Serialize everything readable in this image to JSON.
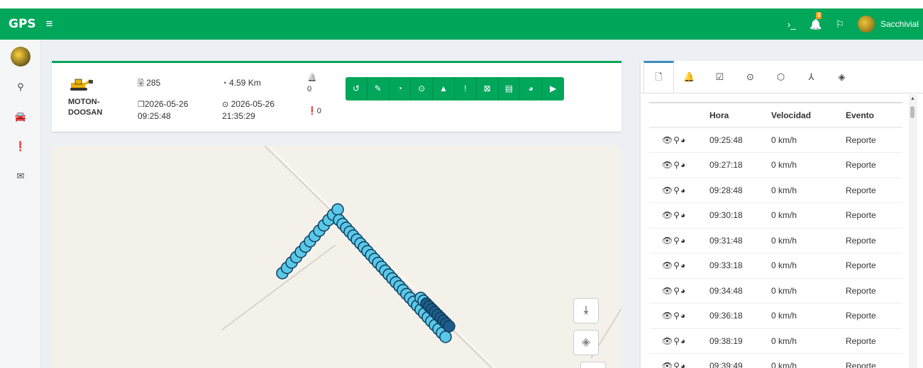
{
  "navbar": {
    "brand": "GPS",
    "menu_icon": "≡",
    "terminal_icon": "›_",
    "bell_icon": "🔔",
    "bell_badge": "0",
    "flag_icon": "⚐",
    "username": "Sacchivial",
    "color": "#00a65a"
  },
  "sidebar": {
    "items": [
      {
        "name": "location-icon",
        "glyph": "⚲"
      },
      {
        "name": "car-icon",
        "glyph": "🚘"
      },
      {
        "name": "alert-icon",
        "glyph": "❗"
      },
      {
        "name": "mail-icon",
        "glyph": "✉"
      }
    ]
  },
  "vehicle": {
    "name_line1": "MOTON-",
    "name_line2": "DOOSAN",
    "count": "285",
    "distance": "4.59 Km",
    "start_date": "2026-05-26",
    "start_time": "09:25:48",
    "end_date": "2026-05-26",
    "end_time": "21:35:29",
    "alerts": "0",
    "warnings": "0"
  },
  "toolbar": {
    "buttons": [
      {
        "name": "history-icon",
        "glyph": "↺"
      },
      {
        "name": "edit-icon",
        "glyph": "✎"
      },
      {
        "name": "speedometer-icon",
        "glyph": "◔"
      },
      {
        "name": "clock-icon",
        "glyph": "⊙"
      },
      {
        "name": "warning-icon",
        "glyph": "▲"
      },
      {
        "name": "exclamation-icon",
        "glyph": "!"
      },
      {
        "name": "excel-icon",
        "glyph": "⊠"
      },
      {
        "name": "document-icon",
        "glyph": "▤"
      },
      {
        "name": "globe-icon",
        "glyph": "◕"
      },
      {
        "name": "play-icon",
        "glyph": "▶"
      }
    ]
  },
  "map": {
    "download_icon": "⤓",
    "layers_icon": "◈"
  },
  "panel": {
    "tabs": [
      {
        "name": "tab-document",
        "glyph": "🗋"
      },
      {
        "name": "tab-alerts",
        "glyph": "🔔"
      },
      {
        "name": "tab-checklist",
        "glyph": "☑"
      },
      {
        "name": "tab-clock",
        "glyph": "⊙"
      },
      {
        "name": "tab-geofence",
        "glyph": "⬡"
      },
      {
        "name": "tab-route",
        "glyph": "⅄"
      },
      {
        "name": "tab-visibility",
        "glyph": "◈"
      }
    ],
    "columns": [
      "",
      "Hora",
      "Velocidad",
      "Evento"
    ],
    "row_icons": "👁⚲◕",
    "rows": [
      {
        "hora": "09:25:48",
        "velocidad": "0 km/h",
        "evento": "Reporte"
      },
      {
        "hora": "09:27:18",
        "velocidad": "0 km/h",
        "evento": "Reporte"
      },
      {
        "hora": "09:28:48",
        "velocidad": "0 km/h",
        "evento": "Reporte"
      },
      {
        "hora": "09:30:18",
        "velocidad": "0 km/h",
        "evento": "Reporte"
      },
      {
        "hora": "09:31:48",
        "velocidad": "0 km/h",
        "evento": "Reporte"
      },
      {
        "hora": "09:33:18",
        "velocidad": "0 km/h",
        "evento": "Reporte"
      },
      {
        "hora": "09:34:48",
        "velocidad": "0 km/h",
        "evento": "Reporte"
      },
      {
        "hora": "09:36:18",
        "velocidad": "0 km/h",
        "evento": "Reporte"
      },
      {
        "hora": "09:38:19",
        "velocidad": "0 km/h",
        "evento": "Reporte"
      },
      {
        "hora": "09:39:49",
        "velocidad": "0 km/h",
        "evento": "Reporte"
      }
    ]
  }
}
